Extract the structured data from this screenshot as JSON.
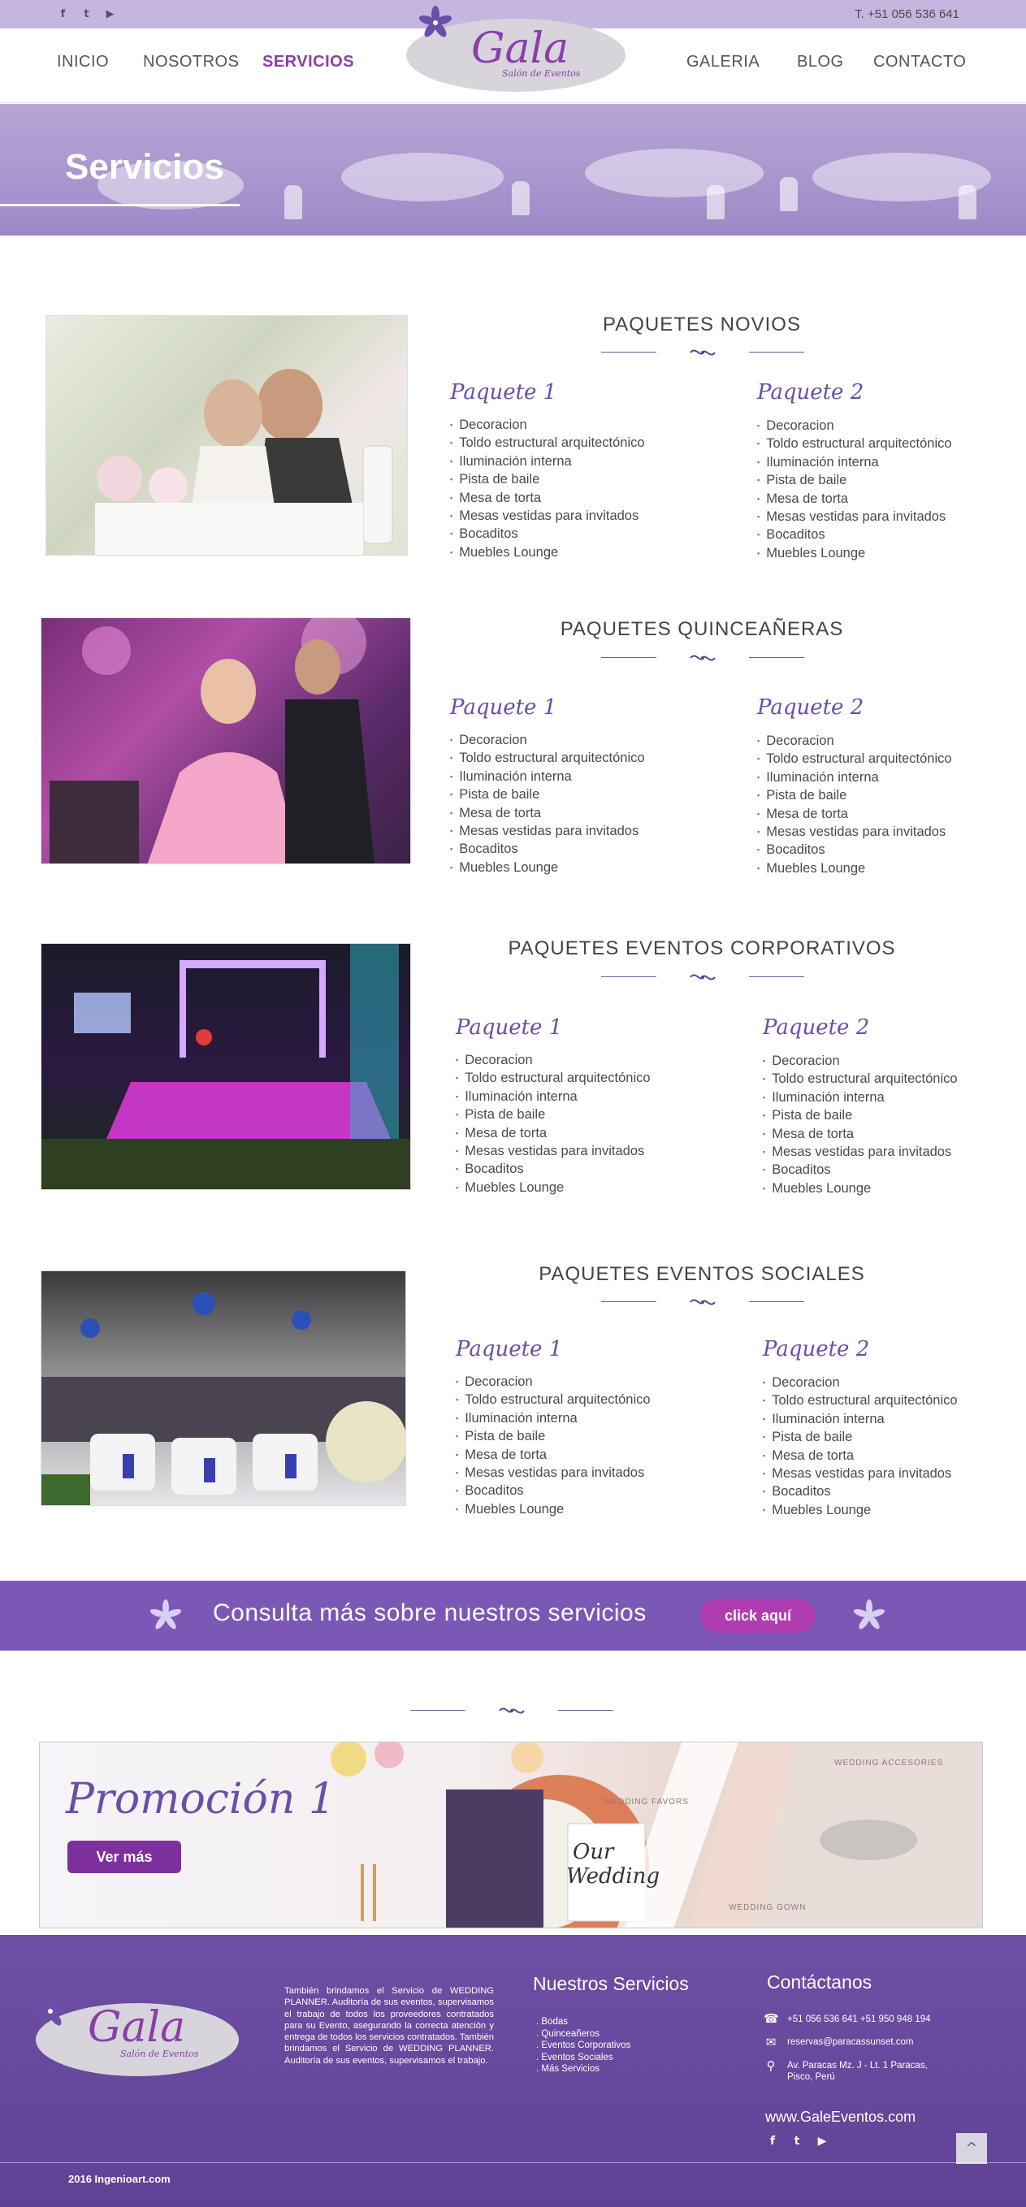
{
  "topbar": {
    "socials": [
      {
        "icon": "facebook-icon",
        "glyph": "f"
      },
      {
        "icon": "twitter-icon",
        "glyph": "t"
      },
      {
        "icon": "youtube-icon",
        "glyph": "▶"
      }
    ],
    "phone": "T. +51 056 536 641"
  },
  "nav": {
    "items": [
      "INICIO",
      "NOSOTROS",
      "SERVICIOS",
      "GALERIA",
      "BLOG",
      "CONTACTO"
    ],
    "active": "SERVICIOS",
    "logo": {
      "name": "Gala",
      "sub": "Salón de Eventos"
    }
  },
  "hero": {
    "title": "Servicios"
  },
  "sections": [
    {
      "title": "PAQUETES NOVIOS",
      "packages": [
        {
          "name": "Paquete 1",
          "items": [
            "Decoracion",
            "Toldo estructural arquitectónico",
            "Iluminación interna",
            "Pista de baile",
            "Mesa de torta",
            "Mesas vestidas para invitados",
            "Bocaditos",
            "Muebles Lounge"
          ]
        },
        {
          "name": "Paquete 2",
          "items": [
            "Decoracion",
            "Toldo estructural arquitectónico",
            "Iluminación interna",
            "Pista de baile",
            "Mesa de torta",
            "Mesas vestidas para invitados",
            "Bocaditos",
            "Muebles Lounge"
          ]
        }
      ]
    },
    {
      "title": "PAQUETES QUINCEAÑERAS",
      "packages": [
        {
          "name": "Paquete 1",
          "items": [
            "Decoracion",
            "Toldo estructural arquitectónico",
            "Iluminación interna",
            "Pista de baile",
            "Mesa de torta",
            "Mesas vestidas para invitados",
            "Bocaditos",
            "Muebles Lounge"
          ]
        },
        {
          "name": "Paquete 2",
          "items": [
            "Decoracion",
            "Toldo estructural arquitectónico",
            "Iluminación interna",
            "Pista de baile",
            "Mesa de torta",
            "Mesas vestidas para invitados",
            "Bocaditos",
            "Muebles Lounge"
          ]
        }
      ]
    },
    {
      "title": "PAQUETES  EVENTOS CORPORATIVOS",
      "packages": [
        {
          "name": "Paquete 1",
          "items": [
            "Decoracion",
            "Toldo estructural arquitectónico",
            "Iluminación interna",
            "Pista de baile",
            "Mesa de torta",
            "Mesas vestidas para invitados",
            "Bocaditos",
            "Muebles Lounge"
          ]
        },
        {
          "name": "Paquete 2",
          "items": [
            "Decoracion",
            "Toldo estructural arquitectónico",
            "Iluminación interna",
            "Pista de baile",
            "Mesa de torta",
            "Mesas vestidas para invitados",
            "Bocaditos",
            "Muebles Lounge"
          ]
        }
      ]
    },
    {
      "title": "PAQUETES  EVENTOS SOCIALES",
      "packages": [
        {
          "name": "Paquete 1",
          "items": [
            "Decoracion",
            "Toldo estructural arquitectónico",
            "Iluminación interna",
            "Pista de baile",
            "Mesa de torta",
            "Mesas vestidas para invitados",
            "Bocaditos",
            "Muebles Lounge"
          ]
        },
        {
          "name": "Paquete 2",
          "items": [
            "Decoracion",
            "Toldo estructural arquitectónico",
            "Iluminación interna",
            "Pista de baile",
            "Mesa de torta",
            "Mesas vestidas para invitados",
            "Bocaditos",
            "Muebles Lounge"
          ]
        }
      ]
    }
  ],
  "cta": {
    "text": "Consulta más sobre nuestros servicios",
    "button": "click aquí"
  },
  "promo": {
    "title": "Promoción 1",
    "button": "Ver más",
    "labels": [
      "WEDDING FAVORS",
      "WEDDING ACCESORIES",
      "WEDDING GOWN"
    ],
    "card": {
      "line1": "Our",
      "line2": "Wedding"
    }
  },
  "footer": {
    "logo": {
      "name": "Gala",
      "sub": "Salón de Eventos"
    },
    "about": "También brindamos el Servicio de WEDDING PLANNER. Auditoría de sus eventos, supervisamos el trabajo de todos los proveedores contratados para su Evento, asegurando la correcta atención y entrega de todos los servicios contratados. También brindamos el Servicio de WEDDING PLANNER. Auditoría de sus eventos, supervisamos el trabajo.",
    "services_title": "Nuestros Servicios",
    "services": [
      ". Bodas",
      ". Quinceañeros",
      ". Eventos Corporativos",
      ". Eventos Sociales",
      ". Más Servicios"
    ],
    "contact_title": "Contáctanos",
    "phones": "+51 056 536 641 +51 950 948 194",
    "email": "reservas@paracassunset.com",
    "address": "Av. Paracas Mz. J - Lt. 1 Paracas, Pisco, Perú",
    "website": "www.GaleEventos.com",
    "socials": [
      {
        "icon": "facebook-icon",
        "glyph": "f"
      },
      {
        "icon": "twitter-icon",
        "glyph": "t"
      },
      {
        "icon": "youtube-icon",
        "glyph": "▶"
      }
    ],
    "back_to_top": "^",
    "copyright": "2016 Ingenioart.com"
  },
  "colors": {
    "accent": "#8a3fa8",
    "purple_band": "#7b58b6",
    "topbar": "#c5b6e0",
    "footer": "#6e4fa3",
    "button_pink": "#b03cb2"
  }
}
